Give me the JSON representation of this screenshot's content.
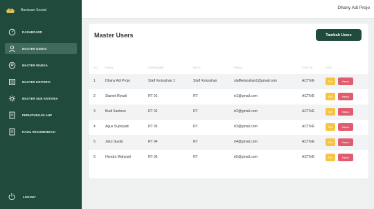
{
  "brand": {
    "name": "Bantuan Sosial"
  },
  "topbar": {
    "user": "Dhany Adi Projo"
  },
  "sidebar": {
    "items": [
      {
        "label": "DASHBOARD",
        "icon": "dashboard-icon"
      },
      {
        "label": "MASTER USERS",
        "icon": "user-icon",
        "active": true
      },
      {
        "label": "MASTER WARGA",
        "icon": "warga-icon"
      },
      {
        "label": "MASTER KRITERIA",
        "icon": "kriteria-icon"
      },
      {
        "label": "MASTER SUB KRITERIA",
        "icon": "sub-kriteria-icon"
      },
      {
        "label": "PERHITUNGAN AHP",
        "icon": "document-icon"
      },
      {
        "label": "HASIL REKOMENDASI",
        "icon": "document-icon"
      }
    ],
    "logout": "LOGOUT"
  },
  "main": {
    "title": "Master Users",
    "add_button": "Tambah Users",
    "columns": [
      "NO",
      "NAMA",
      "USERNAME",
      "ROLE",
      "EMAIL",
      "STATUS",
      "AKSI"
    ],
    "rows": [
      {
        "no": "1",
        "nama": "Dhany Adi Projo",
        "username": "Staff Kelurahan 1",
        "role": "Staff Kelurahan",
        "email": "staffkelurahan1@gmail.com",
        "status": "ACTIVE"
      },
      {
        "no": "2",
        "nama": "Slamet Riyadi",
        "username": "RT 01",
        "role": "RT",
        "email": "rt1@gmail.com",
        "status": "ACTIVE"
      },
      {
        "no": "3",
        "nama": "Budi Santoso",
        "username": "RT 02",
        "role": "RT",
        "email": "rt2@gmail.com",
        "status": "ACTIVE"
      },
      {
        "no": "4",
        "nama": "Agus Supriyadi",
        "username": "RT 03",
        "role": "RT",
        "email": "rt3@gmail.com",
        "status": "ACTIVE"
      },
      {
        "no": "5",
        "nama": "Joko Susilo",
        "username": "RT 04",
        "role": "RT",
        "email": "rt4@gmail.com",
        "status": "ACTIVE"
      },
      {
        "no": "6",
        "nama": "Hendro Wahyudi",
        "username": "RT 05",
        "role": "RT",
        "email": "rt5@gmail.com",
        "status": "ACTIVE"
      }
    ],
    "edit_label": "Edit",
    "delete_label": "Hapus"
  },
  "colors": {
    "sidebar": "#1f4a3c",
    "active": "#3f6a5d",
    "edit": "#f5c542",
    "delete": "#e05d6f"
  }
}
